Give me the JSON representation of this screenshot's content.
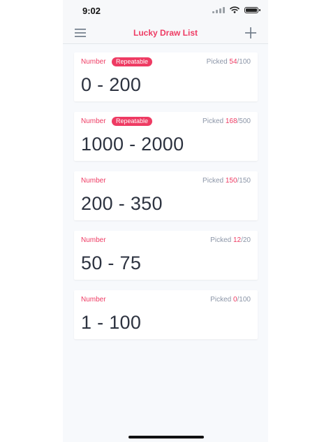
{
  "status_bar": {
    "time": "9:02"
  },
  "header": {
    "title": "Lucky Draw List"
  },
  "draws": [
    {
      "type_label": "Number",
      "badge": "Repeatable",
      "picked_label": "Picked",
      "picked_count": "54",
      "total": "/100",
      "range": "0 - 200"
    },
    {
      "type_label": "Number",
      "badge": "Repeatable",
      "picked_label": "Picked",
      "picked_count": "168",
      "total": "/500",
      "range": "1000 - 2000"
    },
    {
      "type_label": "Number",
      "badge": "",
      "picked_label": "Picked",
      "picked_count": "150",
      "total": "/150",
      "range": "200 - 350"
    },
    {
      "type_label": "Number",
      "badge": "",
      "picked_label": "Picked",
      "picked_count": "12",
      "total": "/20",
      "range": "50 - 75"
    },
    {
      "type_label": "Number",
      "badge": "",
      "picked_label": "Picked",
      "picked_count": "0",
      "total": "/100",
      "range": "1 - 100"
    }
  ],
  "icons": {
    "menu": "hamburger-menu-icon",
    "add": "plus-icon",
    "signal": "cellular-signal-icon",
    "wifi": "wifi-icon",
    "battery": "battery-icon"
  },
  "colors": {
    "accent": "#ee3b63",
    "text": "#2d3340",
    "muted": "#8b95a7",
    "background": "#f7f9fc"
  }
}
